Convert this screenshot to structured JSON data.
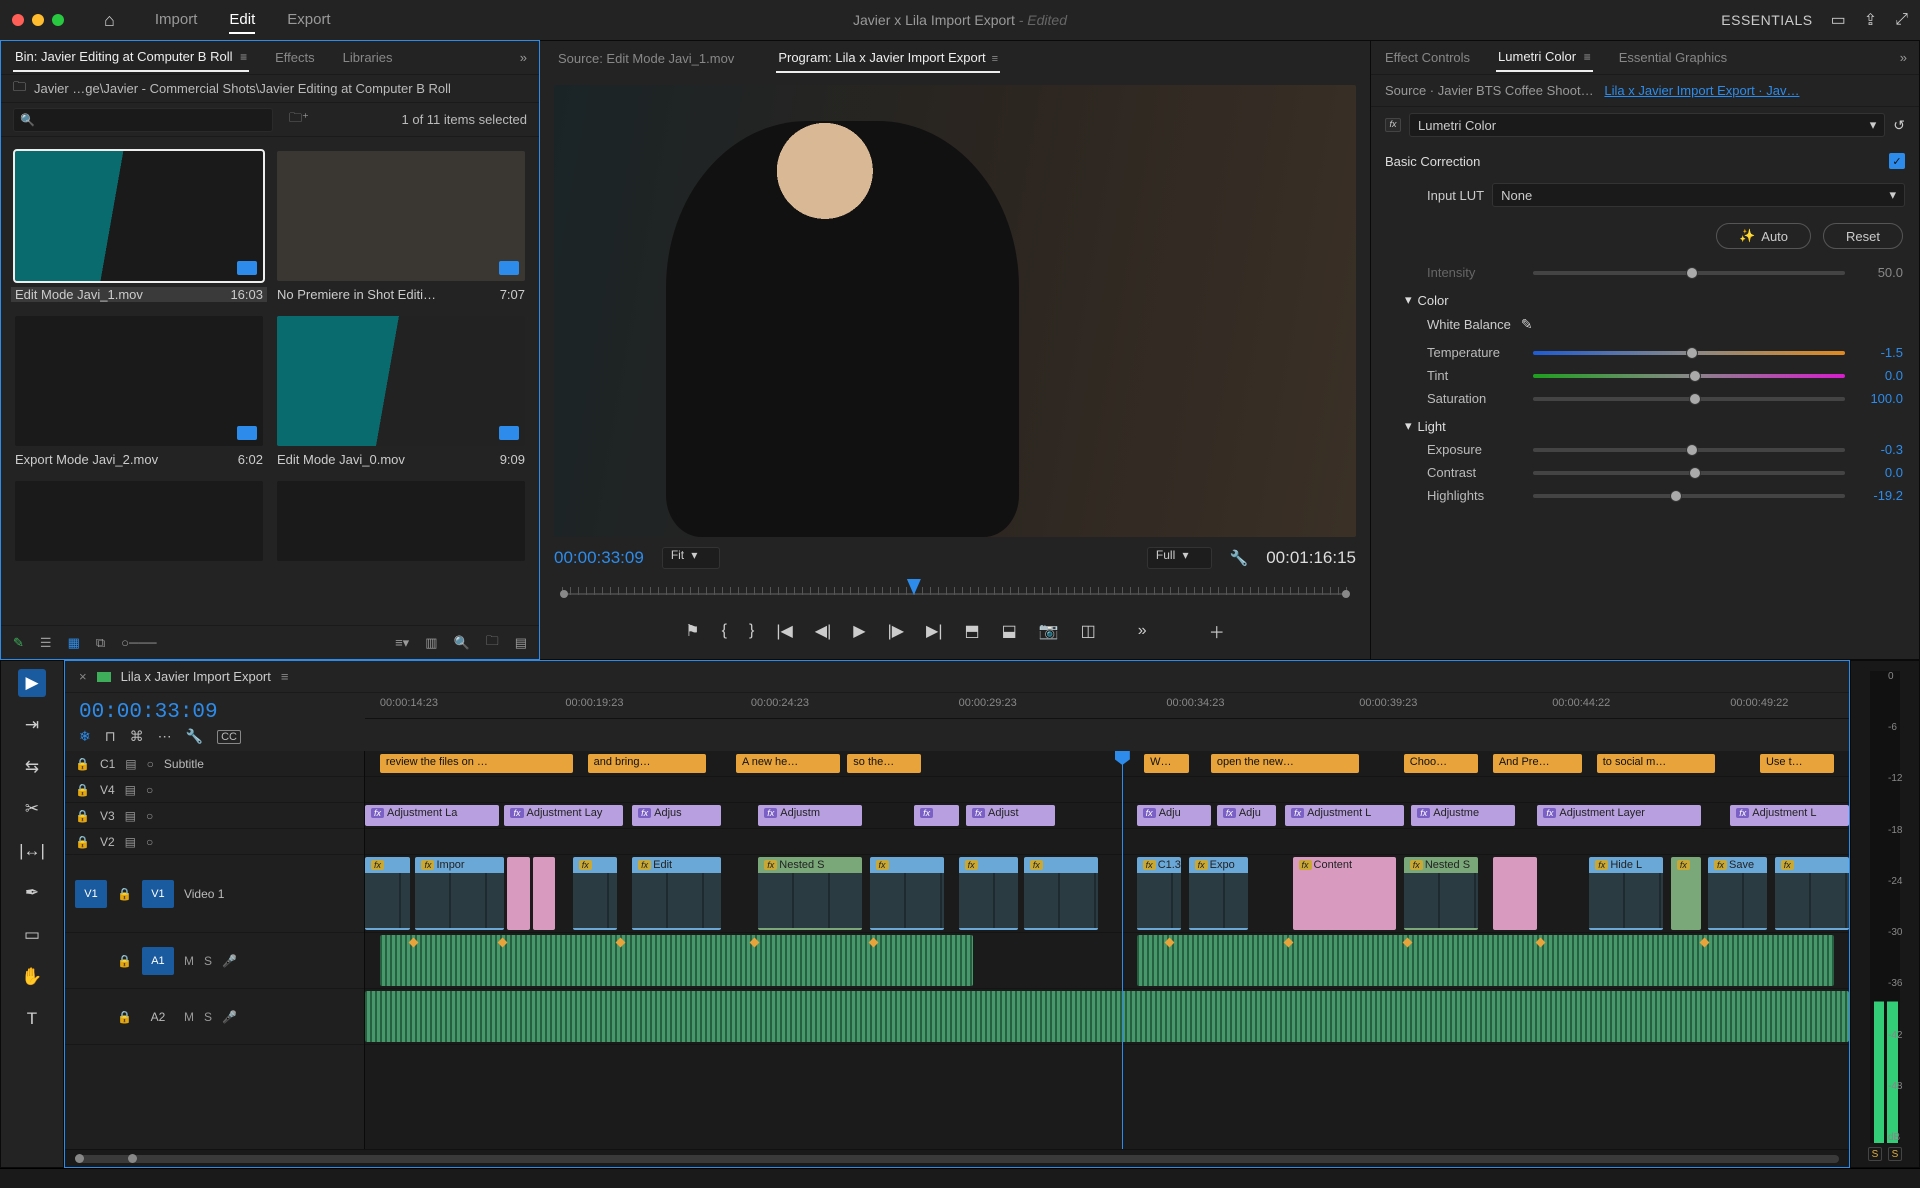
{
  "titlebar": {
    "doc_title": "Javier x Lila Import Export",
    "edited_suffix": " - Edited",
    "essentials": "ESSENTIALS"
  },
  "workspace_tabs": {
    "import": "Import",
    "edit": "Edit",
    "export": "Export"
  },
  "project_panel": {
    "tabs": {
      "bin": "Bin: Javier Editing at Computer B Roll",
      "effects": "Effects",
      "libraries": "Libraries"
    },
    "breadcrumb": "Javier …ge\\Javier - Commercial Shots\\Javier Editing at Computer B Roll",
    "selection": "1 of 11 items selected",
    "items": [
      {
        "name": "Edit Mode Javi_1.mov",
        "dur": "16:03",
        "selected": true
      },
      {
        "name": "No Premiere in Shot Editi…",
        "dur": "7:07"
      },
      {
        "name": "Export Mode Javi_2.mov",
        "dur": "6:02"
      },
      {
        "name": "Edit Mode Javi_0.mov",
        "dur": "9:09"
      }
    ]
  },
  "monitor": {
    "source_tab": "Source: Edit Mode Javi_1.mov",
    "program_tab": "Program: Lila x Javier Import Export",
    "timecode": "00:00:33:09",
    "fit_label": "Fit",
    "zoom_label": "Full",
    "duration": "00:01:16:15"
  },
  "lumetri": {
    "tabs": {
      "ec": "Effect Controls",
      "lc": "Lumetri Color",
      "eg": "Essential Graphics"
    },
    "source_line_a": "Source · Javier BTS Coffee Shoot…",
    "source_line_b": "Lila x Javier Import Export · Jav…",
    "effect_name": "Lumetri Color",
    "basic": "Basic Correction",
    "input_lut": "Input LUT",
    "lut_none": "None",
    "auto": "Auto",
    "reset": "Reset",
    "intensity": "Intensity",
    "intensity_val": "50.0",
    "color": "Color",
    "white_balance": "White Balance",
    "temperature": "Temperature",
    "temperature_val": "-1.5",
    "tint": "Tint",
    "tint_val": "0.0",
    "saturation": "Saturation",
    "saturation_val": "100.0",
    "light": "Light",
    "exposure": "Exposure",
    "exposure_val": "-0.3",
    "contrast": "Contrast",
    "contrast_val": "0.0",
    "highlights": "Highlights",
    "highlights_val": "-19.2"
  },
  "timeline": {
    "seq_name": "Lila x Javier Import Export",
    "timecode": "00:00:33:09",
    "ruler": [
      "00:00:14:23",
      "00:00:19:23",
      "00:00:24:23",
      "00:00:29:23",
      "00:00:34:23",
      "00:00:39:23",
      "00:00:44:22",
      "00:00:49:22"
    ],
    "tracks": {
      "c1": "C1",
      "c1_lbl": "Subtitle",
      "v4": "V4",
      "v3": "V3",
      "v2": "V2",
      "v1": "V1",
      "v1_lbl": "Video 1",
      "a1": "A1",
      "a2": "A2",
      "m": "M",
      "s": "S"
    },
    "captions": [
      "review the files on …",
      "and bring…",
      "A new he…",
      "so the…",
      "W…",
      "open the new…",
      "Choo…",
      "And Pre…",
      "to social m…",
      "Use t…"
    ],
    "adj_label": "Adjustment La",
    "adj_labels": [
      "Adjustment La",
      "Adjustment Lay",
      "Adjus",
      "Adjustm",
      "Adjust",
      "Adju",
      "Adju",
      "Adjustment L",
      "Adjustme",
      "Adjustment Layer",
      "Adjustment L"
    ],
    "v1_clips": [
      "Impor",
      "Edit",
      "Nested S",
      "C1.3",
      "Expo",
      "Content",
      "Nested S",
      "Hide L",
      "Save"
    ]
  },
  "meter": {
    "scale": [
      "0",
      "-6",
      "-12",
      "-18",
      "-24",
      "-30",
      "-36",
      "-42",
      "-48",
      "dB"
    ],
    "solo": "S"
  },
  "icons": {
    "home": "⌂",
    "menu": "≡",
    "dblchev": "»",
    "folder": "🗀",
    "search": "🔍",
    "wrench": "🔧",
    "play": "▶",
    "step_back": "◀",
    "go_start": "⏮",
    "go_end": "⏭",
    "step_fwd": "▸",
    "marker": "⚑",
    "in": "{",
    "out": "}",
    "insert": "⎀",
    "overwrite": "⧉",
    "export_frame": "📷",
    "plus": "＋",
    "lock": "🔒",
    "eye": "👁",
    "chev_down": "▾",
    "check": "✓",
    "reset": "↺",
    "eyedrop": "✎",
    "share": "⇪",
    "full": "⤢",
    "magic": "✨"
  }
}
